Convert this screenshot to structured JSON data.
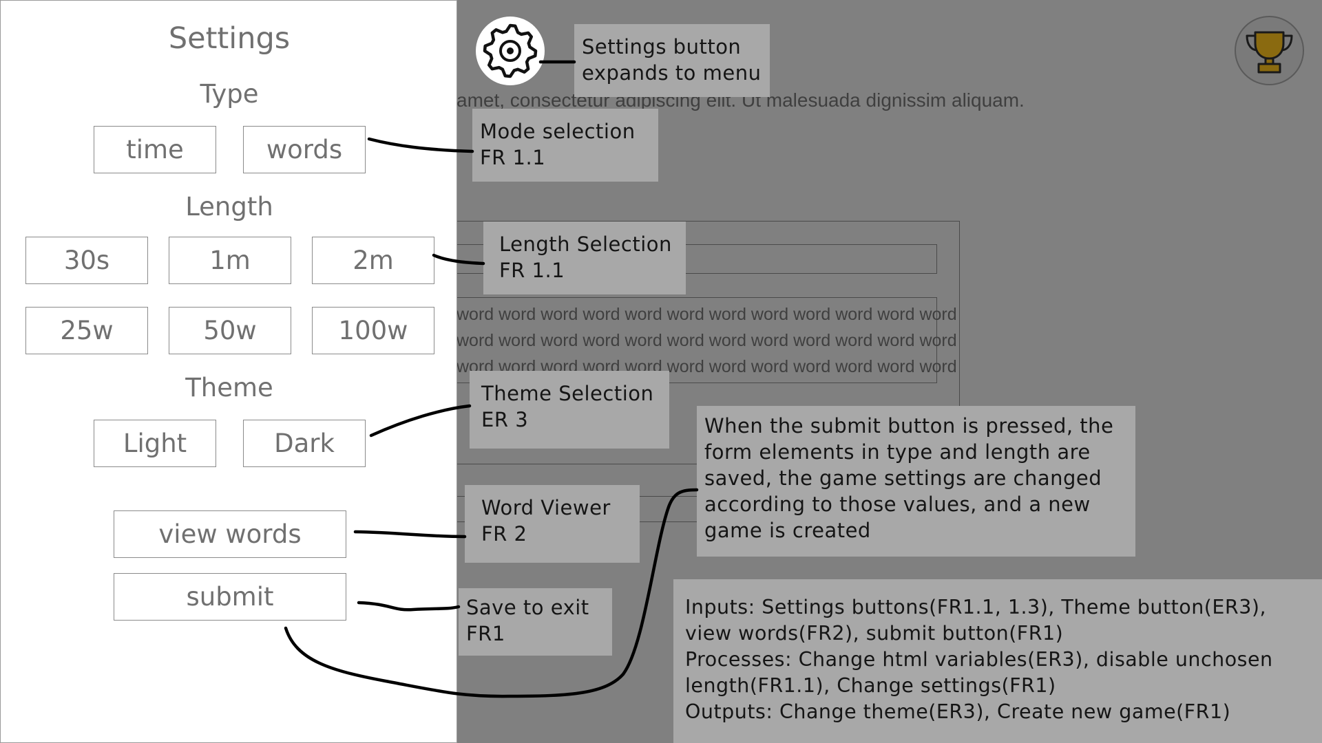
{
  "background": {
    "sentence": "amet, consectetur adipiscing elit. Ut malesuada dignissim aliquam.",
    "word_lines": [
      "word word word word word word word word word word word word",
      "word word word word word word word word word word word word",
      "word word word word word word word word word word word word"
    ],
    "colors": {
      "dim_overlay": "#808080",
      "panel": "#ffffff",
      "callout": "#a8a8a8",
      "trophy": "#8a6a10"
    }
  },
  "icons": {
    "settings": "gear-icon",
    "leaderboard": "trophy-icon"
  },
  "settings_panel": {
    "title": "Settings",
    "type_heading": "Type",
    "type_options": [
      "time",
      "words"
    ],
    "length_heading": "Length",
    "length_options_time": [
      "30s",
      "1m",
      "2m"
    ],
    "length_options_words": [
      "25w",
      "50w",
      "100w"
    ],
    "theme_heading": "Theme",
    "theme_options": [
      "Light",
      "Dark"
    ],
    "view_words_label": "view words",
    "submit_label": "submit"
  },
  "annotations": {
    "settings_button": [
      "Settings button",
      "expands to menu"
    ],
    "mode_selection": [
      "Mode selection",
      "FR 1.1"
    ],
    "length_selection": [
      "Length Selection",
      "FR 1.1"
    ],
    "theme_selection": [
      "Theme Selection",
      "ER 3"
    ],
    "word_viewer": [
      "Word Viewer",
      "FR 2"
    ],
    "save_to_exit": [
      "Save to exit",
      "FR1"
    ],
    "submit_description": [
      "When the submit button is pressed, the",
      "form elements in type and length are",
      "saved, the game settings are changed",
      "according to those values, and a new",
      "game is created"
    ],
    "ipo_summary": [
      "Inputs: Settings buttons(FR1.1, 1.3), Theme button(ER3),",
      "view words(FR2), submit button(FR1)",
      "Processes: Change html variables(ER3), disable unchosen",
      "length(FR1.1), Change settings(FR1)",
      "Outputs: Change theme(ER3), Create new game(FR1)"
    ]
  }
}
